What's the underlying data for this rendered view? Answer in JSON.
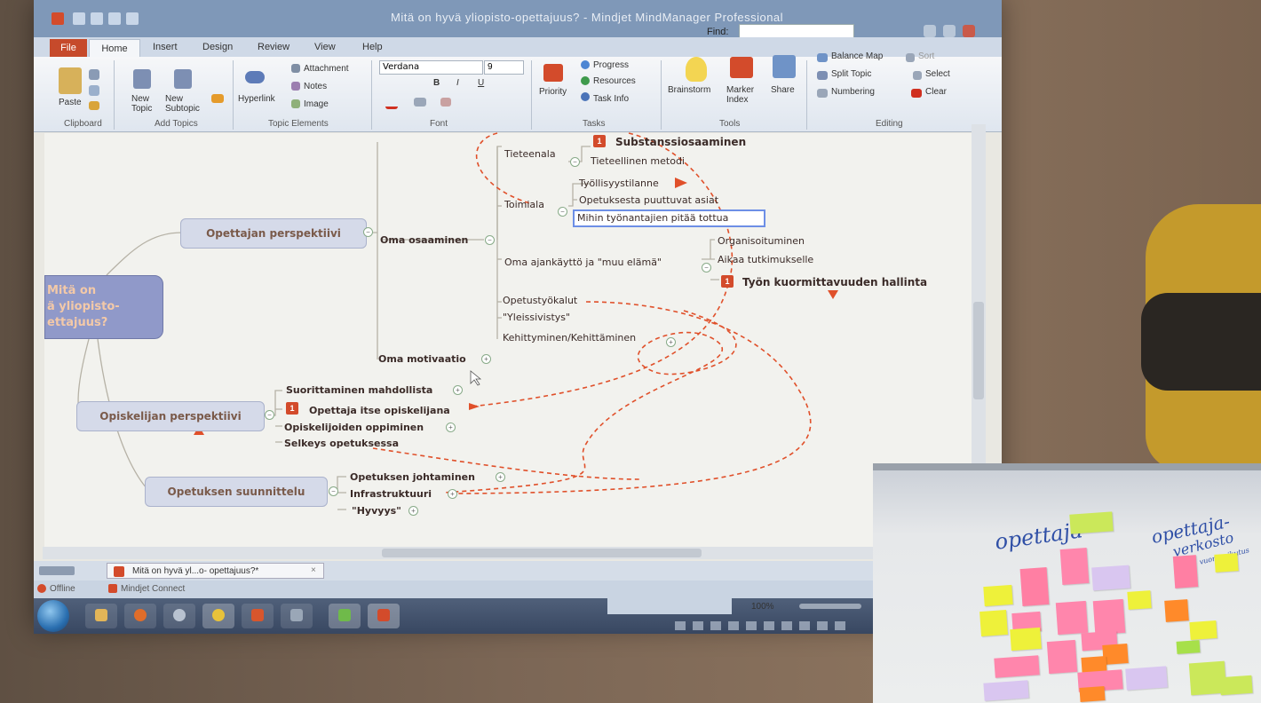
{
  "window": {
    "title": "Mitä on hyvä yliopisto-opettajuus? - Mindjet MindManager Professional",
    "find_label": "Find:"
  },
  "ribbon_tabs": [
    "File",
    "Home",
    "Insert",
    "Design",
    "Review",
    "View",
    "Help"
  ],
  "ribbon": {
    "clipboard": {
      "label": "Clipboard",
      "paste": "Paste"
    },
    "add_topics": {
      "label": "Add Topics",
      "new_topic": "New Topic",
      "new_subtopic": "New Subtopic"
    },
    "topic_elements": {
      "label": "Topic Elements",
      "hyperlink": "Hyperlink",
      "attachment": "Attachment",
      "notes": "Notes",
      "image": "Image"
    },
    "font": {
      "label": "Font",
      "family": "Verdana",
      "size": "9",
      "bold": "B",
      "italic": "I",
      "underline": "U"
    },
    "tasks": {
      "label": "Tasks",
      "priority": "Priority",
      "progress": "Progress",
      "resources": "Resources",
      "task_info": "Task Info"
    },
    "tools": {
      "label": "Tools",
      "brainstorm": "Brainstorm",
      "marker_index": "Marker Index",
      "share": "Share"
    },
    "editing": {
      "label": "Editing",
      "balance_map": "Balance Map",
      "sort": "Sort",
      "split_topic": "Split Topic",
      "select": "Select",
      "numbering": "Numbering",
      "clear": "Clear"
    }
  },
  "mindmap": {
    "root": [
      "Mitä on",
      "ä yliopisto-",
      "ettajuus?"
    ],
    "opettajan": "Opettajan perspektiivi",
    "oma_osaaminen": "Oma osaaminen",
    "tieteenala": "Tieteenala",
    "substanssiosaaminen": "Substanssiosaaminen",
    "tieteellinen_metodi": "Tieteellinen metodi",
    "toimiala": "Toimiala",
    "tyollisyystilanne": "Työllisyystilanne",
    "opetuksesta": "Opetuksesta puuttuvat asiat",
    "mihin": "Mihin työnantajien pitää tottua",
    "oma_ajankaytto": "Oma ajankäyttö ja \"muu elämä\"",
    "organisoituminen": "Organisoituminen",
    "aikaa": "Aikaa tutkimukselle",
    "tyon_kuormittavuuden": "Työn kuormittavuuden hallinta",
    "opetustyokalut": "Opetustyökalut",
    "yleissivistys": "\"Yleissivistys\"",
    "kehittyminen": "Kehittyminen/Kehittäminen",
    "oma_motivaatio": "Oma motivaatio",
    "opiskelijan": "Opiskelijan perspektiivi",
    "suorittaminen": "Suorittaminen mahdollista",
    "opettaja_itse": "Opettaja itse opiskelijana",
    "opiskelijoiden": "Opiskelijoiden oppiminen",
    "selkeys": "Selkeys opetuksessa",
    "suunnittelu": "Opetuksen suunnittelu",
    "johtaminen": "Opetuksen johtaminen",
    "infrastruktuuri": "Infrastruktuuri",
    "hyvyys": "\"Hyvyys\"",
    "flag": "1"
  },
  "doc_tab": "Mitä on hyvä yl...o- opettajuus?*",
  "status": {
    "offline": "Offline",
    "connect": "Mindjet Connect",
    "zoom": "100%"
  },
  "whiteboard": {
    "word1": "opettaja",
    "word2": "opettaja-",
    "word3": "verkosto",
    "word4": "vuorovaikutus"
  }
}
